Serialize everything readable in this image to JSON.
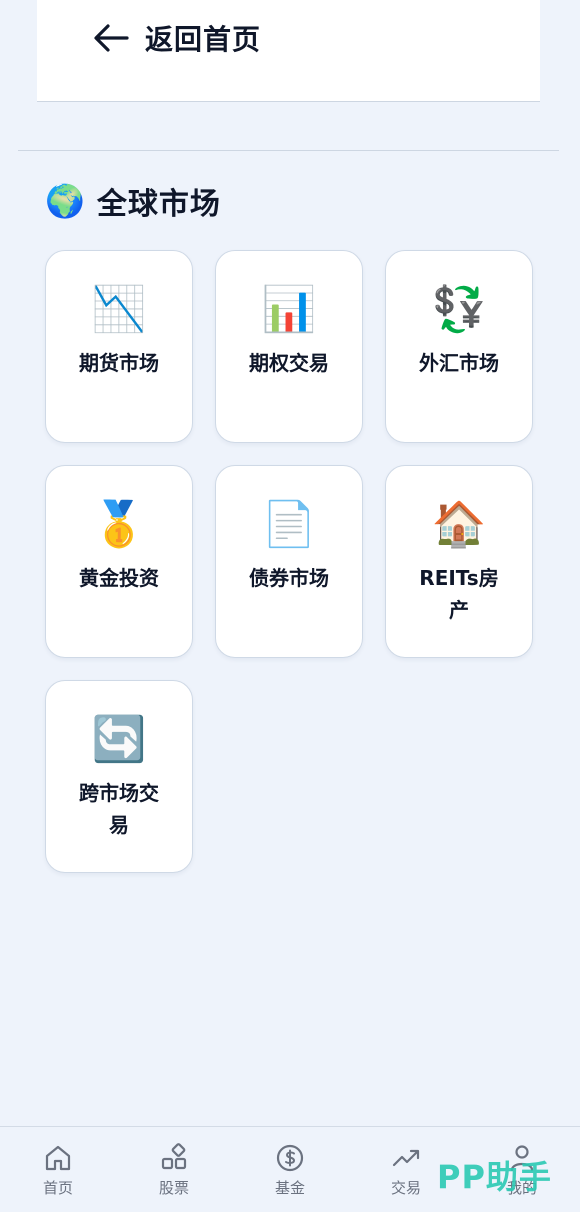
{
  "header": {
    "back_label": "返回首页",
    "back_icon": "arrow-left-icon"
  },
  "section": {
    "icon": "🌍",
    "title": "全球市场"
  },
  "tiles": [
    {
      "icon": "📉",
      "label": "期货市场"
    },
    {
      "icon": "📊",
      "label": "期权交易"
    },
    {
      "icon": "💱",
      "label": "外汇市场"
    },
    {
      "icon": "🥇",
      "label": "黄金投资"
    },
    {
      "icon": "📄",
      "label": "债券市场"
    },
    {
      "icon": "🏠",
      "label": "REITs房产"
    },
    {
      "icon": "🔄",
      "label": "跨市场交易"
    }
  ],
  "nav": [
    {
      "label": "首页",
      "icon": "home-icon"
    },
    {
      "label": "股票",
      "icon": "shapes-icon"
    },
    {
      "label": "基金",
      "icon": "dollar-circle-icon"
    },
    {
      "label": "交易",
      "icon": "trend-up-icon"
    },
    {
      "label": "我的",
      "icon": "user-icon"
    }
  ],
  "watermark": "PP助手",
  "colors": {
    "background": "#eef3fb",
    "card": "#ffffff",
    "watermark": "#2bc9b4",
    "nav_icon": "#6b7280"
  }
}
